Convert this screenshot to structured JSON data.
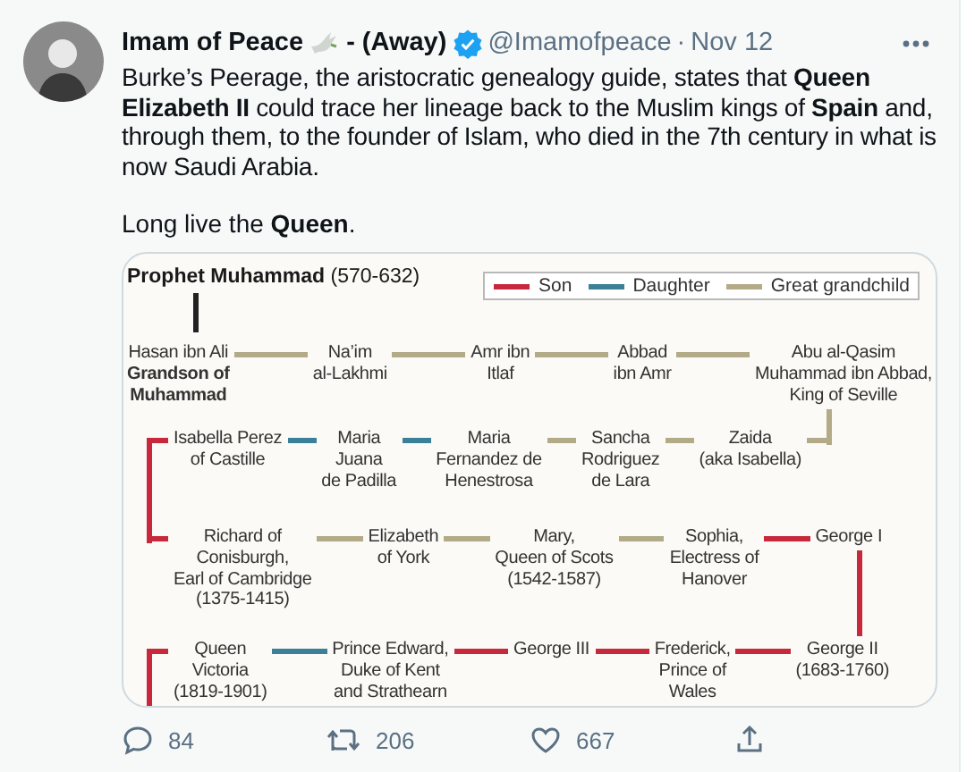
{
  "tweet": {
    "name": "Imam of Peace",
    "name_suffix": "- (Away)",
    "handle": "@Imamofpeace",
    "separator": "·",
    "date": "Nov 12",
    "body": "Burke’s Peerage, the aristocratic genealogy guide, states that **Queen Elizabeth II** could trace her lineage back to the Muslim kings of **Spain** and, through them, to the founder of Islam, who died in the 7th century in what is now Saudi Arabia.",
    "body_2": "Long live the **Queen**.",
    "actions": [
      {
        "kind": "reply",
        "count": "84"
      },
      {
        "kind": "retweet",
        "count": "206"
      },
      {
        "kind": "like",
        "count": "667"
      },
      {
        "kind": "share"
      }
    ]
  },
  "chart": {
    "title": "**Prophet Muhammad** (570-632)",
    "legend": [
      {
        "label": "Son",
        "color": "#c8283c"
      },
      {
        "label": "Daughter",
        "color": "#3b7f99"
      },
      {
        "label": "Great grandchild",
        "color": "#b3aa88"
      }
    ],
    "rows": [
      {
        "turn": {
          "color": "#b3aa88"
        },
        "nodes": [
          {
            "text": "Hasan ibn Ali\n**Grandson of**\n**Muhammad**",
            "link": {
              "color": "#b3aa88"
            }
          },
          {
            "text": "Na’im\nal-Lakhmi",
            "link": {
              "color": "#b3aa88"
            }
          },
          {
            "text": "Amr ibn\nItlaf",
            "link": {
              "color": "#b3aa88"
            }
          },
          {
            "text": "Abbad\nibn Amr",
            "link": {
              "color": "#b3aa88"
            }
          },
          {
            "text": "Abu al-Qasim\nMuhammad ibn Abbad,\nKing of Seville"
          }
        ]
      },
      {
        "turn": {
          "color": "#c8283c"
        },
        "nodes": [
          {
            "text": "Isabella Perez\nof Castille",
            "link": {
              "color": "#3b7f99"
            }
          },
          {
            "text": "Maria\nJuana\nde Padilla",
            "link": {
              "color": "#3b7f99"
            }
          },
          {
            "text": "Maria\nFernandez de\nHenestrosa",
            "link": {
              "color": "#b3aa88"
            }
          },
          {
            "text": "Sancha\nRodriguez\nde Lara",
            "link": {
              "color": "#b3aa88"
            }
          },
          {
            "text": "Zaida\n(aka Isabella)"
          }
        ]
      },
      {
        "turn": {
          "color": "#c8283c"
        },
        "nodes": [
          {
            "text": "Richard of\nConisburgh,\nEarl of Cambridge\n(1375-1415)",
            "link": {
              "color": "#b3aa88"
            }
          },
          {
            "text": "Elizabeth\nof York",
            "link": {
              "color": "#b3aa88"
            }
          },
          {
            "text": "Mary,\nQueen of Scots\n(1542-1587)",
            "link": {
              "color": "#b3aa88"
            }
          },
          {
            "text": "Sophia,\nElectress of\nHanover",
            "link": {
              "color": "#c8283c"
            }
          },
          {
            "text": "George I"
          }
        ]
      },
      {
        "turn": {
          "color": "#c8283c"
        },
        "nodes": [
          {
            "text": "Queen\nVictoria\n(1819-1901)",
            "link": {
              "color": "#3b7f99"
            }
          },
          {
            "text": "Prince Edward,\nDuke of Kent\nand Strathearn",
            "link": {
              "color": "#c8283c"
            }
          },
          {
            "text": "George III",
            "link": {
              "color": "#c8283c"
            }
          },
          {
            "text": "Frederick,\nPrince of\nWales",
            "link": {
              "color": "#c8283c"
            }
          },
          {
            "text": "George II\n(1683-1760)"
          }
        ]
      }
    ]
  }
}
